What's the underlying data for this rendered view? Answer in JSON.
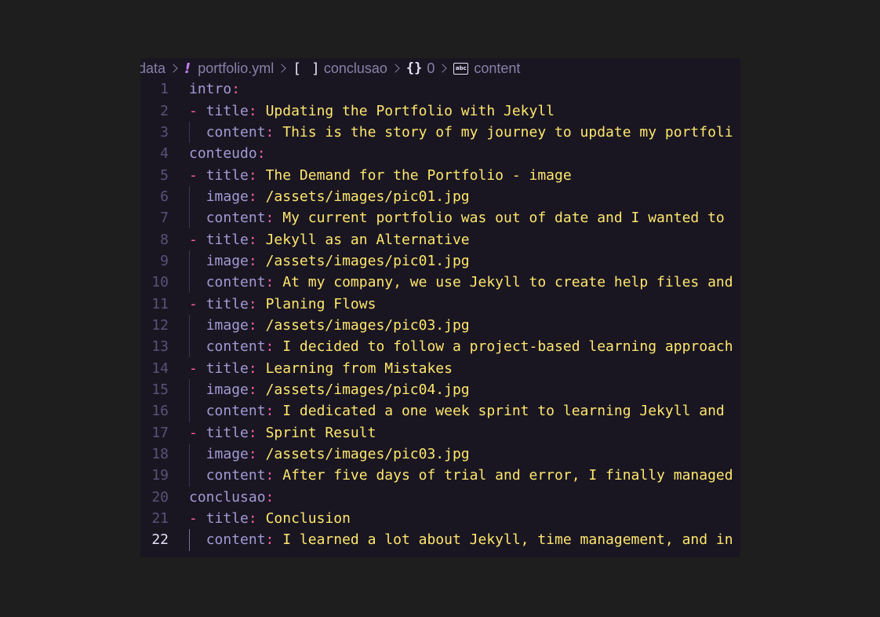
{
  "breadcrumb": [
    {
      "label": "data",
      "icon": null
    },
    {
      "label": "portfolio.yml",
      "icon": "yaml-exclamation-icon"
    },
    {
      "label": "conclusao",
      "icon": "array-brackets-icon"
    },
    {
      "label": "0",
      "icon": "object-braces-icon"
    },
    {
      "label": "content",
      "icon": "string-abc-icon"
    }
  ],
  "icons": {
    "bang": "!",
    "brackets": "[ ]",
    "braces": "{}",
    "abc": "abc"
  },
  "syntax_colors": {
    "background": "#191622",
    "key": "#a39bd4",
    "punctuation": "#ff5ea8",
    "string": "#ffe66d",
    "line_number": "#5a5278"
  },
  "active_line": 22,
  "lines": [
    {
      "n": "1",
      "dash": "",
      "key": "intro",
      "colon": ":",
      "val": ""
    },
    {
      "n": "2",
      "dash": "- ",
      "key": "title",
      "colon": ": ",
      "val": "Updating the Portfolio with Jekyll"
    },
    {
      "n": "3",
      "dash": "  ",
      "key": "content",
      "colon": ": ",
      "val": "This is the story of my journey to update my portfoli"
    },
    {
      "n": "4",
      "dash": "",
      "key": "conteudo",
      "colon": ":",
      "val": ""
    },
    {
      "n": "5",
      "dash": "- ",
      "key": "title",
      "colon": ": ",
      "val": "The Demand for the Portfolio - image"
    },
    {
      "n": "6",
      "dash": "  ",
      "key": "image",
      "colon": ": ",
      "val": "/assets/images/pic01.jpg"
    },
    {
      "n": "7",
      "dash": "  ",
      "key": "content",
      "colon": ": ",
      "val": "My current portfolio was out of date and I wanted to"
    },
    {
      "n": "8",
      "dash": "- ",
      "key": "title",
      "colon": ": ",
      "val": "Jekyll as an Alternative"
    },
    {
      "n": "9",
      "dash": "  ",
      "key": "image",
      "colon": ": ",
      "val": "/assets/images/pic01.jpg"
    },
    {
      "n": "10",
      "dash": "  ",
      "key": "content",
      "colon": ": ",
      "val": "At my company, we use Jekyll to create help files and"
    },
    {
      "n": "11",
      "dash": "- ",
      "key": "title",
      "colon": ": ",
      "val": "Planing Flows"
    },
    {
      "n": "12",
      "dash": "  ",
      "key": "image",
      "colon": ": ",
      "val": "/assets/images/pic03.jpg"
    },
    {
      "n": "13",
      "dash": "  ",
      "key": "content",
      "colon": ": ",
      "val": "I decided to follow a project-based learning approach"
    },
    {
      "n": "14",
      "dash": "- ",
      "key": "title",
      "colon": ": ",
      "val": "Learning from Mistakes"
    },
    {
      "n": "15",
      "dash": "  ",
      "key": "image",
      "colon": ": ",
      "val": "/assets/images/pic04.jpg"
    },
    {
      "n": "16",
      "dash": "  ",
      "key": "content",
      "colon": ": ",
      "val": "I dedicated a one week sprint to learning Jekyll and"
    },
    {
      "n": "17",
      "dash": "- ",
      "key": "title",
      "colon": ": ",
      "val": "Sprint Result"
    },
    {
      "n": "18",
      "dash": "  ",
      "key": "image",
      "colon": ": ",
      "val": "/assets/images/pic03.jpg"
    },
    {
      "n": "19",
      "dash": "  ",
      "key": "content",
      "colon": ": ",
      "val": "After five days of trial and error, I finally managed"
    },
    {
      "n": "20",
      "dash": "",
      "key": "conclusao",
      "colon": ":",
      "val": ""
    },
    {
      "n": "21",
      "dash": "- ",
      "key": "title",
      "colon": ": ",
      "val": "Conclusion"
    },
    {
      "n": "22",
      "dash": "  ",
      "key": "content",
      "colon": ": ",
      "val": "I learned a lot about Jekyll, time management, and in"
    }
  ]
}
